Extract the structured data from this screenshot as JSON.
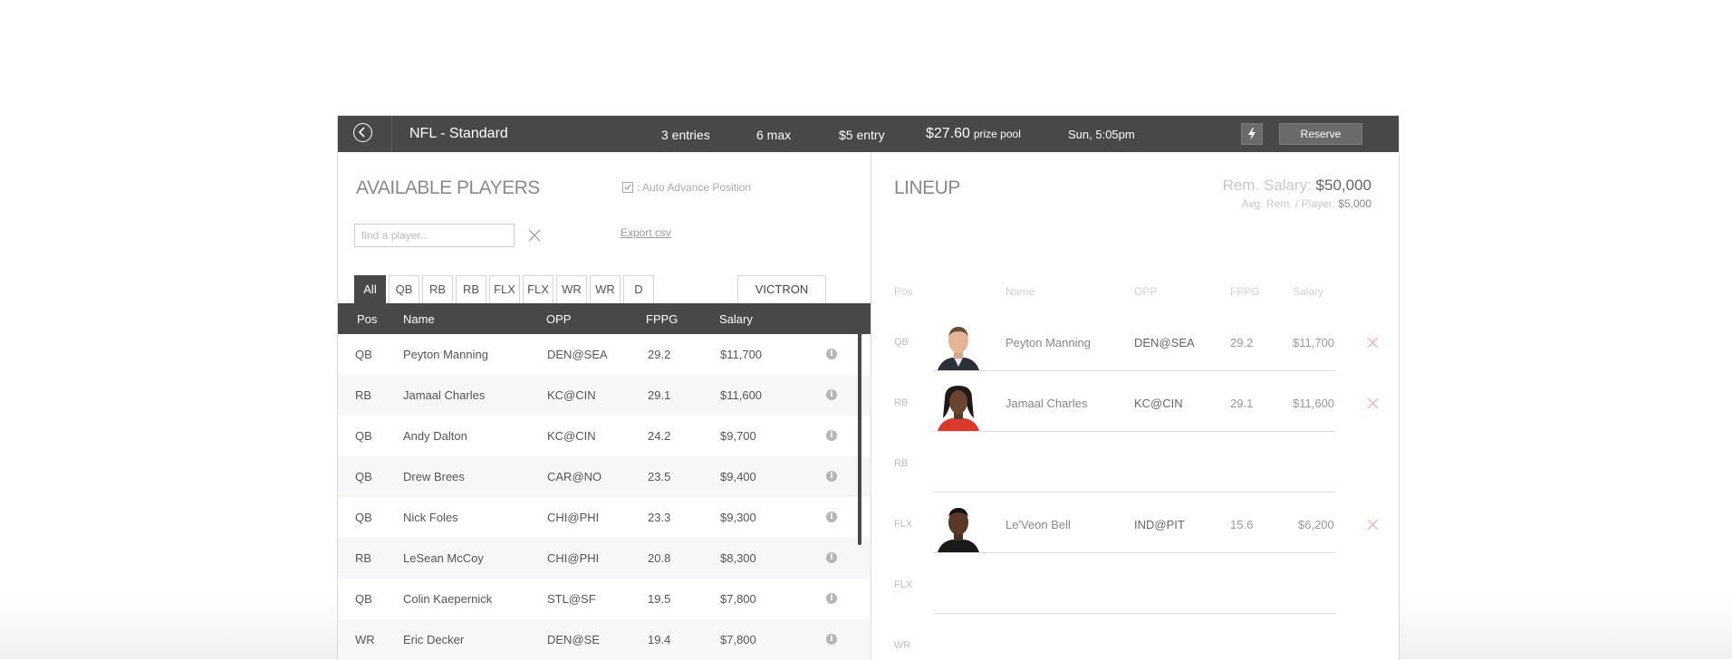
{
  "header": {
    "contest_title": "NFL - Standard",
    "entries": "3 entries",
    "max": "6 max",
    "entry_fee": "$5 entry",
    "prize_amount": "$27.60",
    "prize_label": "prize pool",
    "start_time": "Sun, 5:05pm",
    "reserve_label": "Reserve"
  },
  "available": {
    "title": "AVAILABLE PLAYERS",
    "auto_advance": ": Auto Advance Position",
    "search_placeholder": "find a player...",
    "export_label": "Export csv",
    "tabs": [
      "All",
      "QB",
      "RB",
      "RB",
      "FLX",
      "FLX",
      "WR",
      "WR",
      "D"
    ],
    "team_button": "VICTRON",
    "columns": {
      "pos": "Pos",
      "name": "Name",
      "opp": "OPP",
      "fppg": "FPPG",
      "salary": "Salary"
    },
    "players": [
      {
        "pos": "QB",
        "name": "Peyton Manning",
        "opp": "DEN@SEA",
        "fppg": "29.2",
        "salary": "$11,700"
      },
      {
        "pos": "RB",
        "name": "Jamaal Charles",
        "opp": "KC@CIN",
        "fppg": "29.1",
        "salary": "$11,600"
      },
      {
        "pos": "QB",
        "name": "Andy Dalton",
        "opp": "KC@CIN",
        "fppg": "24.2",
        "salary": "$9,700"
      },
      {
        "pos": "QB",
        "name": "Drew Brees",
        "opp": "CAR@NO",
        "fppg": "23.5",
        "salary": "$9,400"
      },
      {
        "pos": "QB",
        "name": "Nick Foles",
        "opp": "CHI@PHI",
        "fppg": "23.3",
        "salary": "$9,300"
      },
      {
        "pos": "RB",
        "name": "LeSean McCoy",
        "opp": "CHI@PHI",
        "fppg": "20.8",
        "salary": "$8,300"
      },
      {
        "pos": "QB",
        "name": "Colin Kaepernick",
        "opp": "STL@SF",
        "fppg": "19.5",
        "salary": "$7,800"
      },
      {
        "pos": "WR",
        "name": "Eric Decker",
        "opp": "DEN@SE",
        "fppg": "19.4",
        "salary": "$7,800"
      }
    ]
  },
  "lineup": {
    "title": "LINEUP",
    "rem_salary_label": "Rem. Salary:",
    "rem_salary_value": "$50,000",
    "avg_rem_label": "Avg. Rem. / Player:",
    "avg_rem_value": "$5,000",
    "columns": {
      "pos": "Pos",
      "name": "Name",
      "opp": "OPP",
      "fppg": "FPPG",
      "salary": "Salary"
    },
    "slots": [
      {
        "pos": "QB",
        "name": "Peyton Manning",
        "opp": "DEN@SEA",
        "fppg": "29.2",
        "salary": "$11,700"
      },
      {
        "pos": "RB",
        "name": "Jamaal Charles",
        "opp": "KC@CIN",
        "fppg": "29.1",
        "salary": "$11,600"
      },
      {
        "pos": "RB"
      },
      {
        "pos": "FLX",
        "name": "Le'Veon Bell",
        "opp": "IND@PIT",
        "fppg": "15.6",
        "salary": "$6,200"
      },
      {
        "pos": "FLX"
      },
      {
        "pos": "WR"
      }
    ]
  },
  "colors": {
    "topbar": "#484848",
    "remove_x": "#f2a3a3",
    "row_alt": "#f5f7f9"
  }
}
